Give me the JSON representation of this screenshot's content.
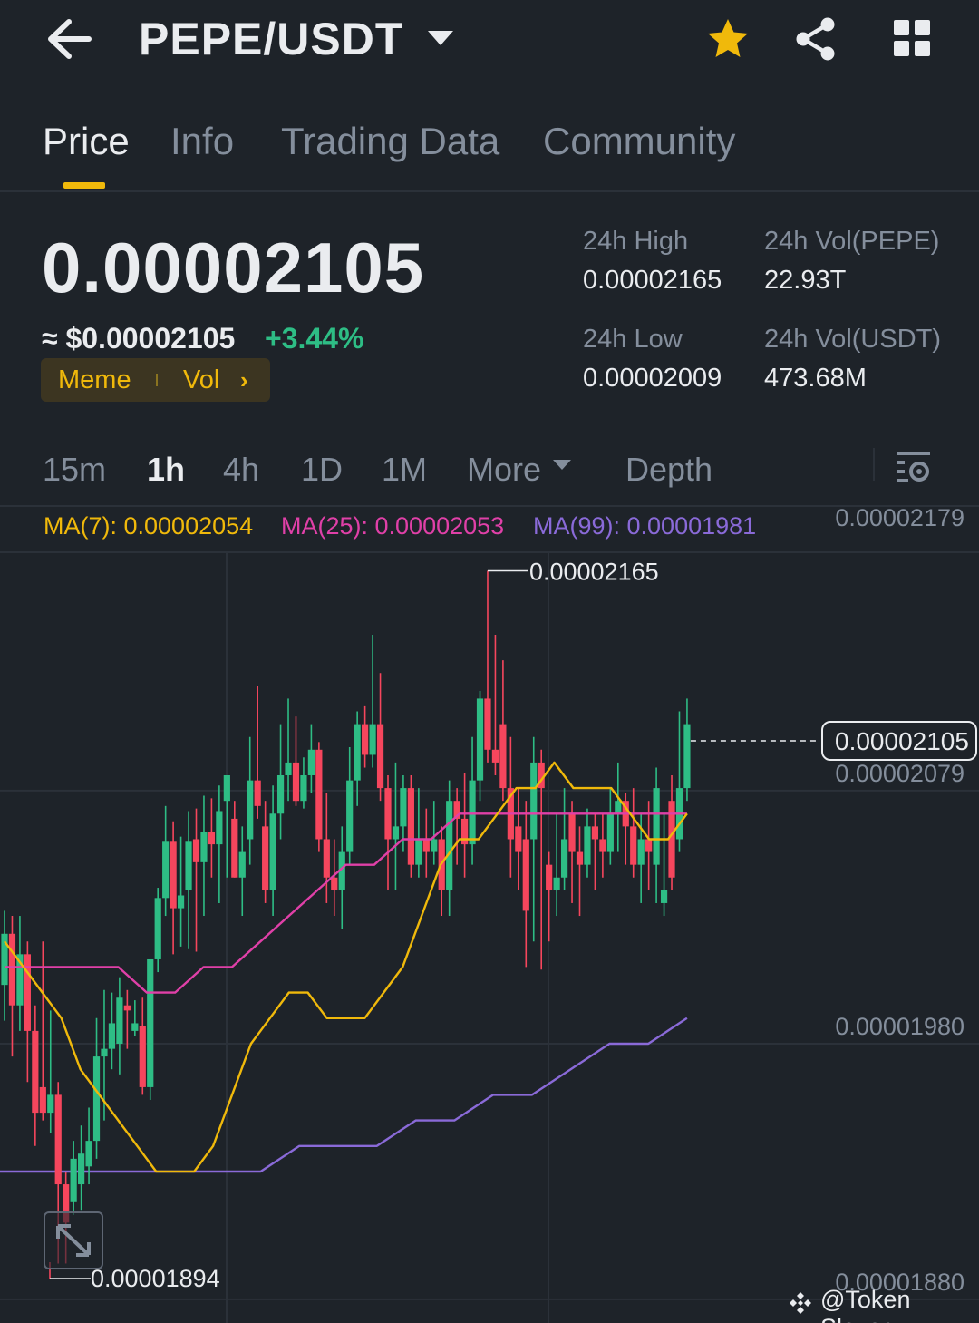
{
  "header": {
    "pair": "PEPE/USDT",
    "icons": [
      "back-arrow-icon",
      "caret-down-icon",
      "star-icon",
      "share-icon",
      "grid-icon"
    ],
    "favorite_color": "#f0b90b"
  },
  "tabs": [
    {
      "label": "Price",
      "active": true
    },
    {
      "label": "Info",
      "active": false
    },
    {
      "label": "Trading Data",
      "active": false
    },
    {
      "label": "Community",
      "active": false
    }
  ],
  "price": {
    "last": "0.00002105",
    "usd": "≈ $0.00002105",
    "change": "+3.44%",
    "change_color": "#2ebd85",
    "tags": [
      "Meme",
      "Vol"
    ]
  },
  "stats": {
    "high_label": "24h High",
    "high_value": "0.00002165",
    "low_label": "24h Low",
    "low_value": "0.00002009",
    "vol_base_label": "24h Vol(PEPE)",
    "vol_base_value": "22.93T",
    "vol_quote_label": "24h Vol(USDT)",
    "vol_quote_value": "473.68M"
  },
  "intervals": [
    "15m",
    "1h",
    "4h",
    "1D",
    "1M",
    "More",
    "Depth"
  ],
  "active_interval": "1h",
  "ma_legend": {
    "ma7": "MA(7): 0.00002054",
    "ma25": "MA(25): 0.00002053",
    "ma99": "MA(99): 0.00001981"
  },
  "colors": {
    "up": "#2ebd85",
    "down": "#f6465d",
    "ma7": "#f0b90b",
    "ma25": "#e040a8",
    "ma99": "#8a6ad8",
    "background": "#1e2329"
  },
  "chart_data": {
    "type": "candlestick",
    "y_ticks": [
      "0.00002179",
      "0.00002079",
      "0.00001980",
      "0.00001880"
    ],
    "ylim": [
      1.88e-05,
      2.18e-05
    ],
    "high_marker": "0.00002165",
    "low_marker": "0.00001894",
    "current_price": "0.00002105",
    "candles": [
      [
        2.003e-05,
        2.023e-05,
        2.032e-05,
        1.989e-05
      ],
      [
        2.023e-05,
        1.995e-05,
        2.03e-05,
        1.975e-05
      ],
      [
        1.995e-05,
        2.015e-05,
        2.03e-05,
        1.985e-05
      ],
      [
        2.015e-05,
        1.985e-05,
        2.02e-05,
        1.965e-05
      ],
      [
        1.985e-05,
        1.953e-05,
        1.995e-05,
        1.94e-05
      ],
      [
        1.963e-05,
        1.953e-05,
        2.02e-05,
        1.95e-05
      ],
      [
        1.953e-05,
        1.96e-05,
        1.993e-05,
        1.945e-05
      ],
      [
        1.96e-05,
        1.925e-05,
        1.965e-05,
        1.894e-05
      ],
      [
        1.925e-05,
        1.91e-05,
        1.93e-05,
        1.894e-05
      ],
      [
        1.918e-05,
        1.935e-05,
        1.942e-05,
        1.913e-05
      ],
      [
        1.925e-05,
        1.937e-05,
        1.948e-05,
        1.915e-05
      ],
      [
        1.932e-05,
        1.942e-05,
        1.955e-05,
        1.925e-05
      ],
      [
        1.942e-05,
        1.975e-05,
        1.99e-05,
        1.935e-05
      ],
      [
        1.975e-05,
        1.978e-05,
        2.001e-05,
        1.95e-05
      ],
      [
        1.978e-05,
        1.988e-05,
        2e-05,
        1.97e-05
      ],
      [
        1.98e-05,
        1.998e-05,
        2.006e-05,
        1.968e-05
      ],
      [
        1.995e-05,
        1.993e-05,
        2.001e-05,
        1.978e-05
      ],
      [
        1.985e-05,
        1.988e-05,
        1.997e-05,
        1.983e-05
      ],
      [
        1.987e-05,
        1.963e-05,
        1.998e-05,
        1.96e-05
      ],
      [
        1.963e-05,
        2.013e-05,
        2.013e-05,
        1.958e-05
      ],
      [
        2.013e-05,
        2.037e-05,
        2.041e-05,
        2.008e-05
      ],
      [
        2.037e-05,
        2.059e-05,
        2.073e-05,
        2.03e-05
      ],
      [
        2.059e-05,
        2.033e-05,
        2.067e-05,
        2.015e-05
      ],
      [
        2.033e-05,
        2.038e-05,
        2.061e-05,
        2.018e-05
      ],
      [
        2.04e-05,
        2.059e-05,
        2.071e-05,
        2.017e-05
      ],
      [
        2.06e-05,
        2.051e-05,
        2.072e-05,
        2.016e-05
      ],
      [
        2.051e-05,
        2.063e-05,
        2.077e-05,
        2.03e-05
      ],
      [
        2.063e-05,
        2.058e-05,
        2.076e-05,
        2.045e-05
      ],
      [
        2.058e-05,
        2.071e-05,
        2.081e-05,
        2.035e-05
      ],
      [
        2.075e-05,
        2.085e-05,
        2.085e-05,
        2.045e-05
      ],
      [
        2.068e-05,
        2.045e-05,
        2.075e-05,
        2.045e-05
      ],
      [
        2.045e-05,
        2.055e-05,
        2.065e-05,
        2.03e-05
      ],
      [
        2.06e-05,
        2.083e-05,
        2.1e-05,
        2.05e-05
      ],
      [
        2.083e-05,
        2.073e-05,
        2.12e-05,
        2.068e-05
      ],
      [
        2.065e-05,
        2.04e-05,
        2.075e-05,
        2.035e-05
      ],
      [
        2.04e-05,
        2.07e-05,
        2.081e-05,
        2.03e-05
      ],
      [
        2.07e-05,
        2.085e-05,
        2.105e-05,
        2.06e-05
      ],
      [
        2.085e-05,
        2.09e-05,
        2.115e-05,
        2.075e-05
      ],
      [
        2.09e-05,
        2.075e-05,
        2.108e-05,
        2.073e-05
      ],
      [
        2.075e-05,
        2.085e-05,
        2.092e-05,
        2.072e-05
      ],
      [
        2.085e-05,
        2.095e-05,
        2.105e-05,
        2.078e-05
      ],
      [
        2.095e-05,
        2.06e-05,
        2.098e-05,
        2.055e-05
      ],
      [
        2.06e-05,
        2.045e-05,
        2.078e-05,
        2.035e-05
      ],
      [
        2.045e-05,
        2.04e-05,
        2.06e-05,
        2.03e-05
      ],
      [
        2.04e-05,
        2.055e-05,
        2.065e-05,
        2.025e-05
      ],
      [
        2.055e-05,
        2.083e-05,
        2.096e-05,
        2.05e-05
      ],
      [
        2.083e-05,
        2.105e-05,
        2.11e-05,
        2.073e-05
      ],
      [
        2.105e-05,
        2.093e-05,
        2.112e-05,
        2.088e-05
      ],
      [
        2.093e-05,
        2.105e-05,
        2.14e-05,
        2.088e-05
      ],
      [
        2.105e-05,
        2.08e-05,
        2.125e-05,
        2.075e-05
      ],
      [
        2.08e-05,
        2.06e-05,
        2.085e-05,
        2.04e-05
      ],
      [
        2.06e-05,
        2.065e-05,
        2.09e-05,
        2.04e-05
      ],
      [
        2.065e-05,
        2.08e-05,
        2.085e-05,
        2.055e-05
      ],
      [
        2.08e-05,
        2.05e-05,
        2.085e-05,
        2.045e-05
      ],
      [
        2.05e-05,
        2.06e-05,
        2.08e-05,
        2.045e-05
      ],
      [
        2.06e-05,
        2.055e-05,
        2.072e-05,
        2.045e-05
      ],
      [
        2.055e-05,
        2.06e-05,
        2.075e-05,
        2.05e-05
      ],
      [
        2.06e-05,
        2.04e-05,
        2.065e-05,
        2.03e-05
      ],
      [
        2.04e-05,
        2.075e-05,
        2.083e-05,
        2.03e-05
      ],
      [
        2.075e-05,
        2.068e-05,
        2.08e-05,
        2.05e-05
      ],
      [
        2.068e-05,
        2.058e-05,
        2.086e-05,
        2.045e-05
      ],
      [
        2.058e-05,
        2.083e-05,
        2.1e-05,
        2.05e-05
      ],
      [
        2.083e-05,
        2.115e-05,
        2.118e-05,
        2.075e-05
      ],
      [
        2.115e-05,
        2.095e-05,
        2.165e-05,
        2.09e-05
      ],
      [
        2.095e-05,
        2.09e-05,
        2.14e-05,
        2.085e-05
      ],
      [
        2.105e-05,
        2.08e-05,
        2.13e-05,
        2.075e-05
      ],
      [
        2.08e-05,
        2.06e-05,
        2.1e-05,
        2.045e-05
      ],
      [
        2.065e-05,
        2.055e-05,
        2.08e-05,
        2.04e-05
      ],
      [
        2.06e-05,
        2.032e-05,
        2.075e-05,
        2.01e-05
      ],
      [
        2.06e-05,
        2.09e-05,
        2.1e-05,
        2.02e-05
      ],
      [
        2.09e-05,
        2.08e-05,
        2.095e-05,
        2.009e-05
      ],
      [
        2.05e-05,
        2.04e-05,
        2.055e-05,
        2.02e-05
      ],
      [
        2.04e-05,
        2.045e-05,
        2.07e-05,
        2.03e-05
      ],
      [
        2.045e-05,
        2.06e-05,
        2.08e-05,
        2.04e-05
      ],
      [
        2.07e-05,
        2.055e-05,
        2.075e-05,
        2.035e-05
      ],
      [
        2.055e-05,
        2.05e-05,
        2.065e-05,
        2.03e-05
      ],
      [
        2.05e-05,
        2.065e-05,
        2.072e-05,
        2.045e-05
      ],
      [
        2.065e-05,
        2.06e-05,
        2.07e-05,
        2.04e-05
      ],
      [
        2.06e-05,
        2.055e-05,
        2.07e-05,
        2.045e-05
      ],
      [
        2.055e-05,
        2.07e-05,
        2.08e-05,
        2.05e-05
      ],
      [
        2.07e-05,
        2.075e-05,
        2.09e-05,
        2.055e-05
      ],
      [
        2.075e-05,
        2.065e-05,
        2.078e-05,
        2.05e-05
      ],
      [
        2.065e-05,
        2.05e-05,
        2.08e-05,
        2.045e-05
      ],
      [
        2.05e-05,
        2.06e-05,
        2.07e-05,
        2.035e-05
      ],
      [
        2.06e-05,
        2.055e-05,
        2.075e-05,
        2.04e-05
      ],
      [
        2.05e-05,
        2.08e-05,
        2.088e-05,
        2.035e-05
      ],
      [
        2.035e-05,
        2.04e-05,
        2.07e-05,
        2.03e-05
      ],
      [
        2.075e-05,
        2.045e-05,
        2.085e-05,
        2.04e-05
      ],
      [
        2.06e-05,
        2.08e-05,
        2.11e-05,
        2.055e-05
      ],
      [
        2.08e-05,
        2.105e-05,
        2.115e-05,
        2.075e-05
      ]
    ],
    "ma7": [
      2.02e-05,
      2.01e-05,
      2e-05,
      1.99e-05,
      1.97e-05,
      1.96e-05,
      1.95e-05,
      1.94e-05,
      1.93e-05,
      1.93e-05,
      1.93e-05,
      1.94e-05,
      1.96e-05,
      1.98e-05,
      1.99e-05,
      2e-05,
      2e-05,
      1.99e-05,
      1.99e-05,
      1.99e-05,
      2e-05,
      2.01e-05,
      2.03e-05,
      2.05e-05,
      2.06e-05,
      2.06e-05,
      2.07e-05,
      2.08e-05,
      2.08e-05,
      2.09e-05,
      2.08e-05,
      2.08e-05,
      2.08e-05,
      2.07e-05,
      2.06e-05,
      2.06e-05,
      2.07e-05
    ],
    "ma25": [
      2.01e-05,
      2.01e-05,
      2.01e-05,
      2.01e-05,
      2.01e-05,
      2e-05,
      2e-05,
      2.01e-05,
      2.01e-05,
      2.02e-05,
      2.03e-05,
      2.04e-05,
      2.05e-05,
      2.05e-05,
      2.06e-05,
      2.06e-05,
      2.07e-05,
      2.07e-05,
      2.07e-05,
      2.07e-05,
      2.07e-05,
      2.07e-05,
      2.07e-05,
      2.07e-05,
      2.07e-05
    ],
    "ma99": [
      1.93e-05,
      1.93e-05,
      1.93e-05,
      1.93e-05,
      1.93e-05,
      1.93e-05,
      1.93e-05,
      1.93e-05,
      1.94e-05,
      1.94e-05,
      1.94e-05,
      1.95e-05,
      1.95e-05,
      1.96e-05,
      1.96e-05,
      1.97e-05,
      1.98e-05,
      1.98e-05,
      1.99e-05
    ]
  },
  "watermark": "@Token Slayer"
}
